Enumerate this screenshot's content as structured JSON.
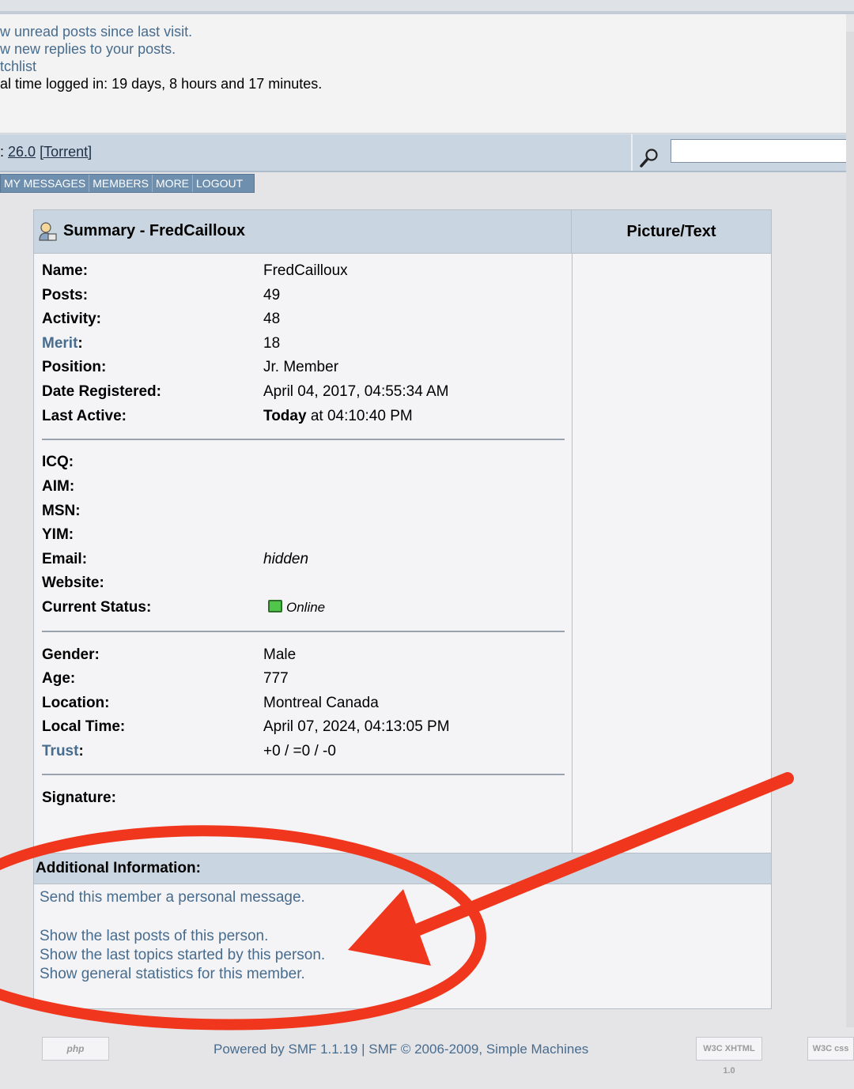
{
  "user_links": {
    "unread": "w unread posts since last visit.",
    "replies": "w new replies to your posts.",
    "watchlist": "tchlist",
    "time_logged": "al time logged in: 19 days, 8 hours and 17 minutes."
  },
  "news": {
    "prefix": ": ",
    "version": "26.0",
    "torrent": "[Torrent]"
  },
  "search": {
    "value": ""
  },
  "menu": [
    "MY MESSAGES",
    "MEMBERS",
    "MORE",
    "LOGOUT"
  ],
  "profile": {
    "title": "Summary - FredCailloux",
    "picture_header": "Picture/Text",
    "rows1": [
      {
        "label": "Name:",
        "value": "FredCailloux"
      },
      {
        "label": "Posts:",
        "value": "49"
      },
      {
        "label": "Activity:",
        "value": "48"
      },
      {
        "label": "Merit",
        "value": "18"
      },
      {
        "label": "Position:",
        "value": "Jr. Member"
      },
      {
        "label": "Date Registered:",
        "value": "April 04, 2017, 04:55:34 AM"
      },
      {
        "label": "Last Active:",
        "value_bold": "Today",
        "value": " at 04:10:40 PM"
      }
    ],
    "rows2": [
      {
        "label": "ICQ:",
        "value": ""
      },
      {
        "label": "AIM:",
        "value": ""
      },
      {
        "label": "MSN:",
        "value": ""
      },
      {
        "label": "YIM:",
        "value": ""
      },
      {
        "label": "Email:",
        "value": "hidden"
      },
      {
        "label": "Website:",
        "value": ""
      },
      {
        "label": "Current Status:",
        "value": "Online"
      }
    ],
    "rows3": [
      {
        "label": "Gender:",
        "value": "Male"
      },
      {
        "label": "Age:",
        "value": "777"
      },
      {
        "label": "Location:",
        "value": "Montreal Canada"
      },
      {
        "label": "Local Time:",
        "value": "April 07, 2024, 04:13:05 PM"
      },
      {
        "label": "Trust",
        "value": "+0 / =0 / -0"
      }
    ],
    "signature_label": "Signature:",
    "additional": {
      "header": "Additional Information:",
      "pm": "Send this member a personal message.",
      "last_posts": "Show the last posts of this person.",
      "last_topics": "Show the last topics started by this person.",
      "stats": "Show general statistics for this member."
    }
  },
  "footer": {
    "text": "Powered by SMF 1.1.19 | SMF © 2006-2009, Simple Machines",
    "php_badge": "php",
    "xhtml_badge": "W3C XHTML 1.0",
    "css_badge": "W3C css"
  },
  "annotation": {
    "color": "#f0361c"
  }
}
